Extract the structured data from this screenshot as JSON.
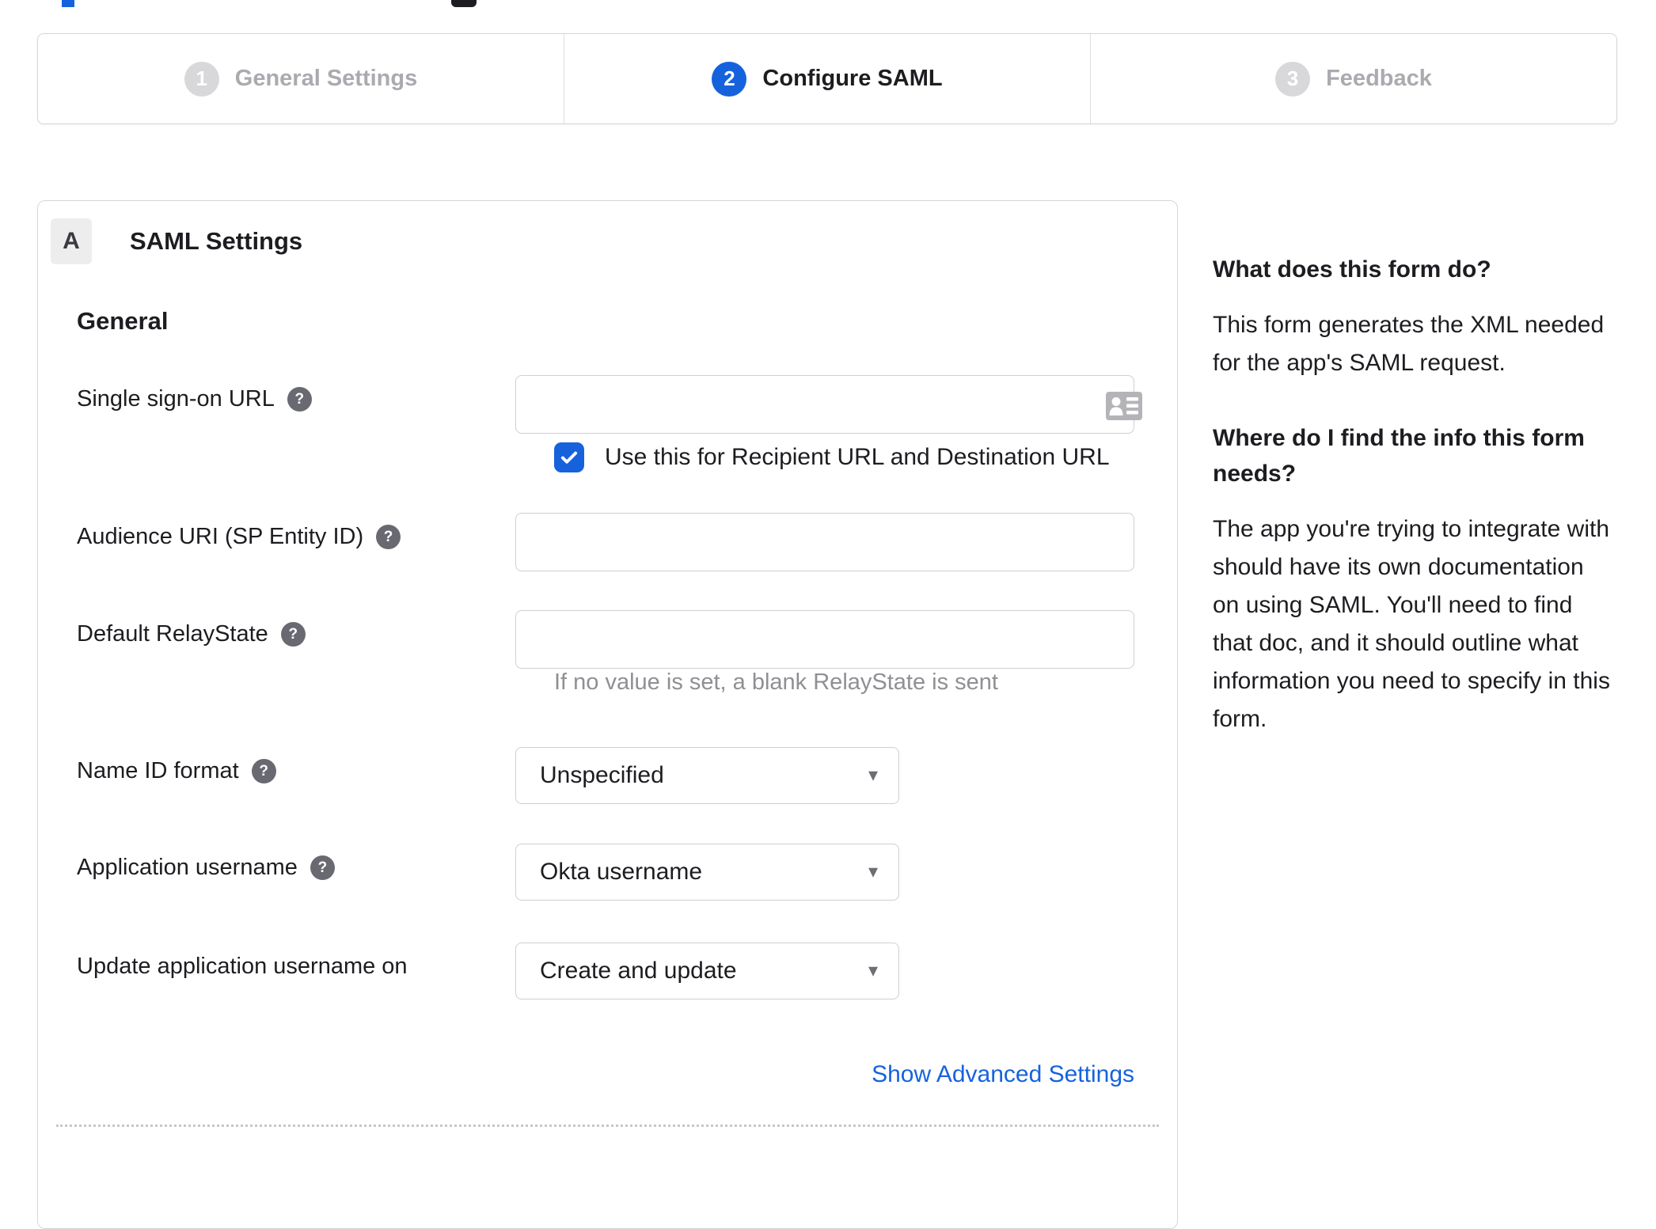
{
  "colors": {
    "accent_blue": "#1662dd",
    "text_dark": "#1d1d21",
    "muted_gray": "#8f8f94",
    "inactive_gray": "#aaaaaf",
    "border_gray": "#d6d6d9"
  },
  "icons": {
    "help_glyph": "?",
    "caret_glyph": "▾",
    "sso_input_icon": "address-card-icon",
    "checkbox_icon": "checkmark-icon"
  },
  "stepper": {
    "steps": [
      {
        "number": "1",
        "label": "General Settings",
        "state": "inactive"
      },
      {
        "number": "2",
        "label": "Configure SAML",
        "state": "active"
      },
      {
        "number": "3",
        "label": "Feedback",
        "state": "inactive"
      }
    ]
  },
  "panel": {
    "section_badge": "A",
    "section_title": "SAML Settings",
    "group_heading": "General",
    "fields": {
      "sso_url": {
        "label": "Single sign-on URL",
        "value": "",
        "placeholder": "",
        "checkbox_label": "Use this for Recipient URL and Destination URL",
        "checkbox_checked": true
      },
      "audience_uri": {
        "label": "Audience URI (SP Entity ID)",
        "value": "",
        "placeholder": ""
      },
      "relay_state": {
        "label": "Default RelayState",
        "value": "",
        "placeholder": "",
        "hint": "If no value is set, a blank RelayState is sent"
      },
      "name_id": {
        "label": "Name ID format",
        "value": "Unspecified"
      },
      "app_username": {
        "label": "Application username",
        "value": "Okta username"
      },
      "update_username": {
        "label": "Update application username on",
        "value": "Create and update"
      }
    },
    "advanced_link": "Show Advanced Settings"
  },
  "sidebar": {
    "q1": "What does this form do?",
    "a1": "This form generates the XML needed for the app's SAML request.",
    "q2": "Where do I find the info this form needs?",
    "a2": "The app you're trying to integrate with should have its own documentation on using SAML. You'll need to find that doc, and it should outline what information you need to specify in this form."
  }
}
